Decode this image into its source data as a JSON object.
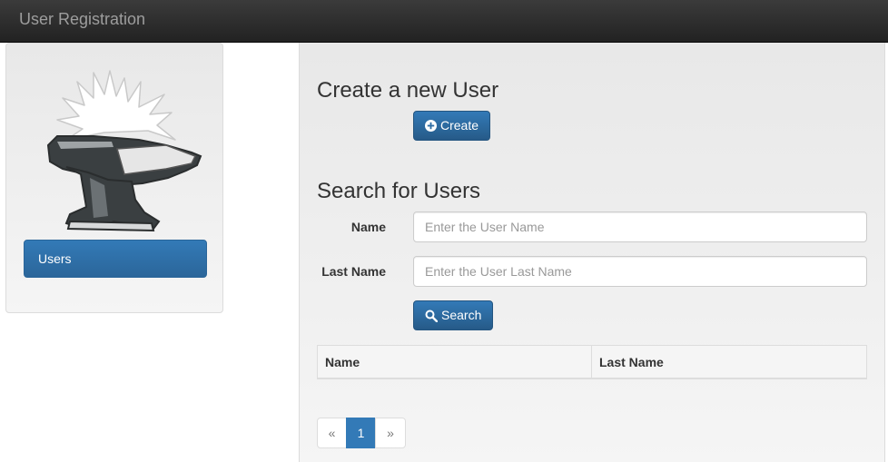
{
  "navbar": {
    "brand": "User Registration"
  },
  "sidebar": {
    "logo_icon": "anvil-icon",
    "items": [
      {
        "label": "Users",
        "active": true
      }
    ]
  },
  "create_section": {
    "title": "Create a new User",
    "create_button": {
      "label": "Create",
      "icon": "plus-circle-icon"
    }
  },
  "search_section": {
    "title": "Search for Users",
    "fields": [
      {
        "label": "Name",
        "value": "",
        "placeholder": "Enter the User Name"
      },
      {
        "label": "Last Name",
        "value": "",
        "placeholder": "Enter the User Last Name"
      }
    ],
    "search_button": {
      "label": "Search",
      "icon": "search-icon"
    }
  },
  "results_table": {
    "columns": [
      "Name",
      "Last Name"
    ],
    "rows": []
  },
  "pagination": {
    "prev": "«",
    "pages": [
      "1"
    ],
    "current": "1",
    "next": "»"
  },
  "colors": {
    "primary": "#337ab7",
    "navbar": "#222222",
    "panel": "#f0f0f0"
  }
}
